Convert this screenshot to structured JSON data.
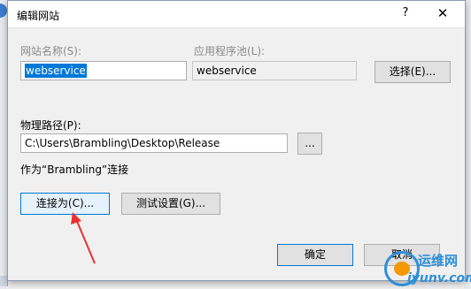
{
  "window": {
    "title": "编辑网站",
    "help_glyph": "?",
    "close_glyph": "✕"
  },
  "site_name": {
    "label": "网站名称(S):",
    "value": "webservice"
  },
  "app_pool": {
    "label": "应用程序池(L):",
    "value": "webservice",
    "select_button": "选择(E)..."
  },
  "physical_path": {
    "label": "物理路径(P):",
    "value": "C:\\Users\\Brambling\\Desktop\\Release",
    "browse_button": "..."
  },
  "connect_as": {
    "info": "作为“Brambling”连接",
    "connect_button": "连接为(C)...",
    "test_button": "测试设置(G)..."
  },
  "footer": {
    "ok_button": "确定",
    "cancel_button": "取消"
  },
  "watermark": {
    "name": "运维网",
    "url": "iyunv.com"
  },
  "colors": {
    "accent": "#0078d7",
    "arrow": "#e8312f",
    "watermark": "#2e8fd9"
  }
}
